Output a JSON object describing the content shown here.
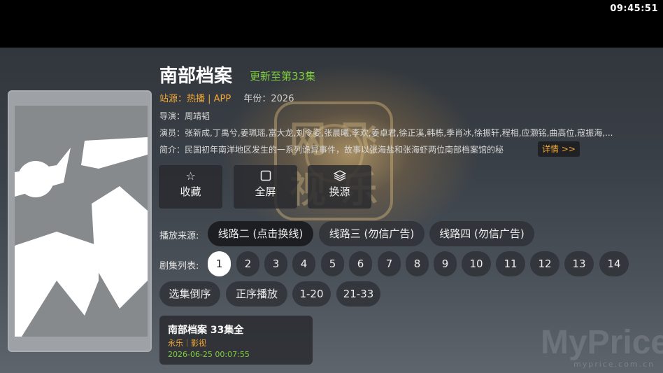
{
  "status_bar": {
    "time": "09:45:51"
  },
  "title": "南部档案",
  "update_status": "更新至第33集",
  "source": {
    "label": "站源：",
    "value": "热播 | APP",
    "year_label": "年份：",
    "year": "2026"
  },
  "director": "导演：周靖韬",
  "cast": "演员：张新成,丁禹兮,姜珮瑶,富大龙,刘令姿,张晨曦,李欢,姜卓君,徐正溪,韩栋,季肖冰,徐振轩,程相,应灏铭,曲高位,寇振海,...",
  "synopsis": "简介：民国初年南洋地区发生的一系列诡异事件，故事以张海盐和张海虾两位南部档案馆的秘",
  "detail_button": "详情 >>",
  "actions": [
    {
      "icon": "star-icon",
      "label": "收藏"
    },
    {
      "icon": "fullscreen-icon",
      "label": "全屏"
    },
    {
      "icon": "layers-icon",
      "label": "换源"
    }
  ],
  "play_source_label": "播放来源:",
  "play_sources": [
    "线路二 (点击换线)",
    "线路三 (勿信广告)",
    "线路四 (勿信广告)"
  ],
  "episode_list_label": "剧集列表:",
  "episodes": [
    "1",
    "2",
    "3",
    "4",
    "5",
    "6",
    "7",
    "8",
    "9",
    "10",
    "11",
    "12",
    "13",
    "14"
  ],
  "active_episode": "1",
  "episode_controls": [
    "选集倒序",
    "正序播放",
    "1-20",
    "21-33"
  ],
  "card": {
    "title": "南部档案 33集全",
    "subtitle": "永乐｜影视",
    "date": "2026-06-25 00:07:55"
  },
  "watermark": {
    "main": "MyPrice",
    "sub": "myprice.com.cn"
  },
  "logo_text": {
    "top_left": "网",
    "top_right": "飞",
    "bottom_left": "视",
    "bottom_right": "乐"
  },
  "colors": {
    "accent_orange": "#f3a734",
    "accent_green": "#7fcf3e",
    "topbar": "#000000"
  }
}
